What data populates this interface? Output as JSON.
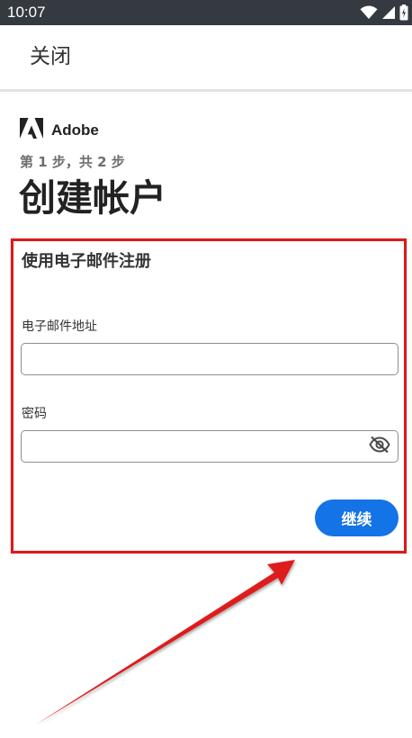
{
  "status_bar": {
    "time": "10:07",
    "icons": [
      "wifi-icon",
      "cellular-signal-icon",
      "battery-icon"
    ]
  },
  "top_bar": {
    "close_label": "关闭"
  },
  "brand": {
    "logo_icon": "adobe-logo-icon",
    "name": "Adobe"
  },
  "header": {
    "step": "第 1 步，共 2 步",
    "title": "创建帐户"
  },
  "form": {
    "heading": "使用电子邮件注册",
    "email": {
      "label": "电子邮件地址",
      "value": "",
      "placeholder": ""
    },
    "password": {
      "label": "密码",
      "value": "",
      "placeholder": "",
      "toggle_icon": "eye-slash-icon"
    },
    "continue_label": "继续"
  },
  "annotation": {
    "color": "#de1a1a"
  },
  "colors": {
    "accent": "#1473e6",
    "status_bar": "#343a40"
  }
}
